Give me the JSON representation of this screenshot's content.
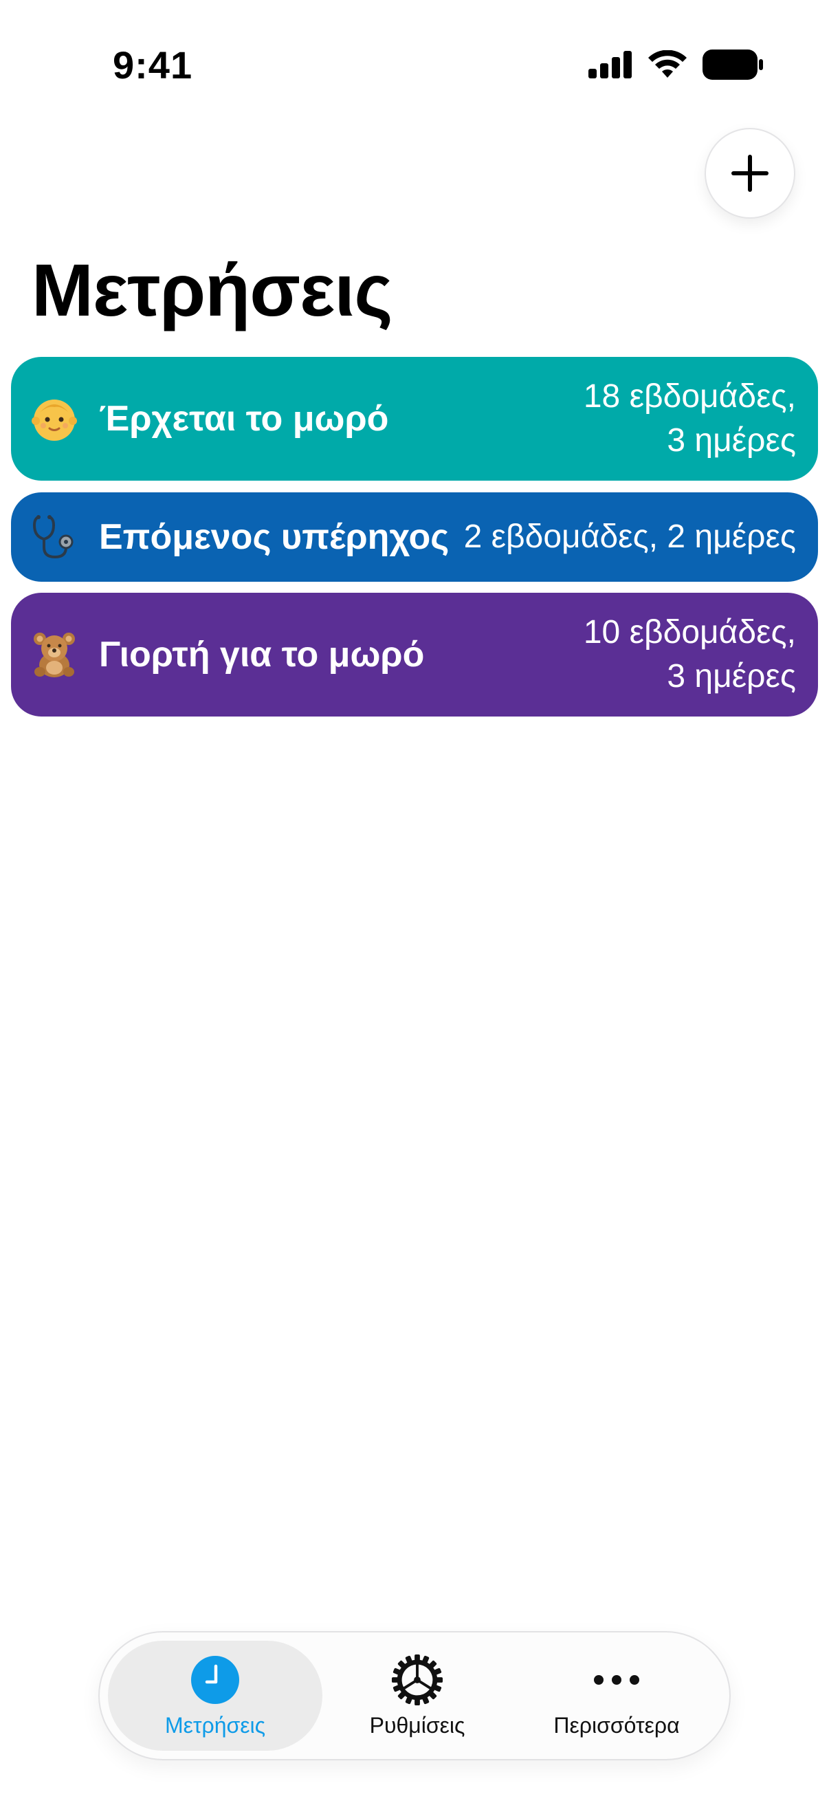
{
  "status_bar": {
    "time": "9:41"
  },
  "header": {
    "title": "Μετρήσεις",
    "add_icon": "plus-icon"
  },
  "countdowns": [
    {
      "emoji": "baby-emoji",
      "title": "Έρχεται το μωρό",
      "value_line1": "18 εβδομάδες,",
      "value_line2": "3 ημέρες",
      "color": "#00aaa9"
    },
    {
      "emoji": "stethoscope-emoji",
      "title": "Επόμενος υπέρηχος",
      "value": "2 εβδομάδες, 2 ημέρες",
      "color": "#0a63b2"
    },
    {
      "emoji": "teddy-bear-emoji",
      "title": "Γιορτή για το μωρό",
      "value_line1": "10 εβδομάδες,",
      "value_line2": "3 ημέρες",
      "color": "#5b2f95"
    }
  ],
  "tab_bar": {
    "tabs": [
      {
        "label": "Μετρήσεις",
        "icon": "clock-icon",
        "active": true
      },
      {
        "label": "Ρυθμίσεις",
        "icon": "gear-icon",
        "active": false
      },
      {
        "label": "Περισσότερα",
        "icon": "ellipsis-icon",
        "active": false
      }
    ],
    "accent": "#0e9be8"
  }
}
